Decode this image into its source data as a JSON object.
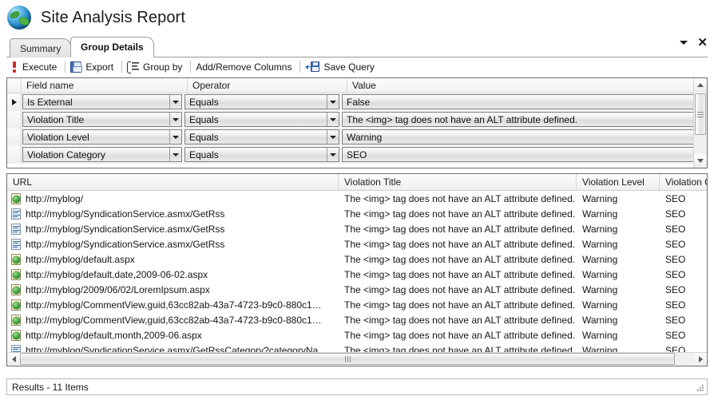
{
  "window": {
    "title": "Site Analysis Report",
    "logo_icon": "globe-icon",
    "minimize_label": "▼",
    "close_label": "✕"
  },
  "tabs": [
    {
      "label": "Summary",
      "active": false
    },
    {
      "label": "Group Details",
      "active": true
    }
  ],
  "toolbar": {
    "items": [
      {
        "label": "Execute",
        "icon": "execute-icon"
      },
      {
        "label": "Export",
        "icon": "save-disk-icon"
      },
      {
        "label": "Group by",
        "icon": "group-by-icon"
      },
      {
        "label": "Add/Remove Columns",
        "icon": ""
      },
      {
        "label": "Save Query",
        "icon": "save-query-icon"
      }
    ]
  },
  "filter": {
    "headers": [
      "Field name",
      "Operator",
      "Value"
    ],
    "rows": [
      {
        "field": "Is External",
        "operator": "Equals",
        "value": "False",
        "selected": true
      },
      {
        "field": "Violation Title",
        "operator": "Equals",
        "value": "The <img> tag does not have an ALT attribute defined.",
        "selected": false
      },
      {
        "field": "Violation Level",
        "operator": "Equals",
        "value": "Warning",
        "selected": false
      },
      {
        "field": "Violation Category",
        "operator": "Equals",
        "value": "SEO",
        "selected": false
      }
    ]
  },
  "results": {
    "headers": [
      "URL",
      "Violation Title",
      "Violation Level",
      "Violation Ca"
    ],
    "rows": [
      {
        "icon": "html-page-icon",
        "url": "http://myblog/",
        "title": "The <img> tag does not have an ALT attribute defined.",
        "level": "Warning",
        "category": "SEO"
      },
      {
        "icon": "xml-page-icon",
        "url": "http://myblog/SyndicationService.asmx/GetRss",
        "title": "The <img> tag does not have an ALT attribute defined.",
        "level": "Warning",
        "category": "SEO"
      },
      {
        "icon": "xml-page-icon",
        "url": "http://myblog/SyndicationService.asmx/GetRss",
        "title": "The <img> tag does not have an ALT attribute defined.",
        "level": "Warning",
        "category": "SEO"
      },
      {
        "icon": "xml-page-icon",
        "url": "http://myblog/SyndicationService.asmx/GetRss",
        "title": "The <img> tag does not have an ALT attribute defined.",
        "level": "Warning",
        "category": "SEO"
      },
      {
        "icon": "html-page-icon",
        "url": "http://myblog/default.aspx",
        "title": "The <img> tag does not have an ALT attribute defined.",
        "level": "Warning",
        "category": "SEO"
      },
      {
        "icon": "html-page-icon",
        "url": "http://myblog/default,date,2009-06-02.aspx",
        "title": "The <img> tag does not have an ALT attribute defined.",
        "level": "Warning",
        "category": "SEO"
      },
      {
        "icon": "html-page-icon",
        "url": "http://myblog/2009/06/02/LoremIpsum.aspx",
        "title": "The <img> tag does not have an ALT attribute defined.",
        "level": "Warning",
        "category": "SEO"
      },
      {
        "icon": "html-page-icon",
        "url": "http://myblog/CommentView,guid,63cc82ab-43a7-4723-b9c0-880c1…",
        "title": "The <img> tag does not have an ALT attribute defined.",
        "level": "Warning",
        "category": "SEO"
      },
      {
        "icon": "html-page-icon",
        "url": "http://myblog/CommentView,guid,63cc82ab-43a7-4723-b9c0-880c1…",
        "title": "The <img> tag does not have an ALT attribute defined.",
        "level": "Warning",
        "category": "SEO"
      },
      {
        "icon": "html-page-icon",
        "url": "http://myblog/default,month,2009-06.aspx",
        "title": "The <img> tag does not have an ALT attribute defined.",
        "level": "Warning",
        "category": "SEO"
      },
      {
        "icon": "xml-page-icon",
        "url": "http://myblog/SyndicationService.asmx/GetRssCategory?categoryNa…",
        "title": "The <img> tag does not have an ALT attribute defined.",
        "level": "Warning",
        "category": "SEO"
      }
    ]
  },
  "statusbar": {
    "text": "Results - 11 Items"
  },
  "colors": {
    "accent": "#3f6fb5",
    "execute_icon": "#c9302c",
    "border": "#6f6f6f",
    "header_bg": "#f0f0f0"
  }
}
